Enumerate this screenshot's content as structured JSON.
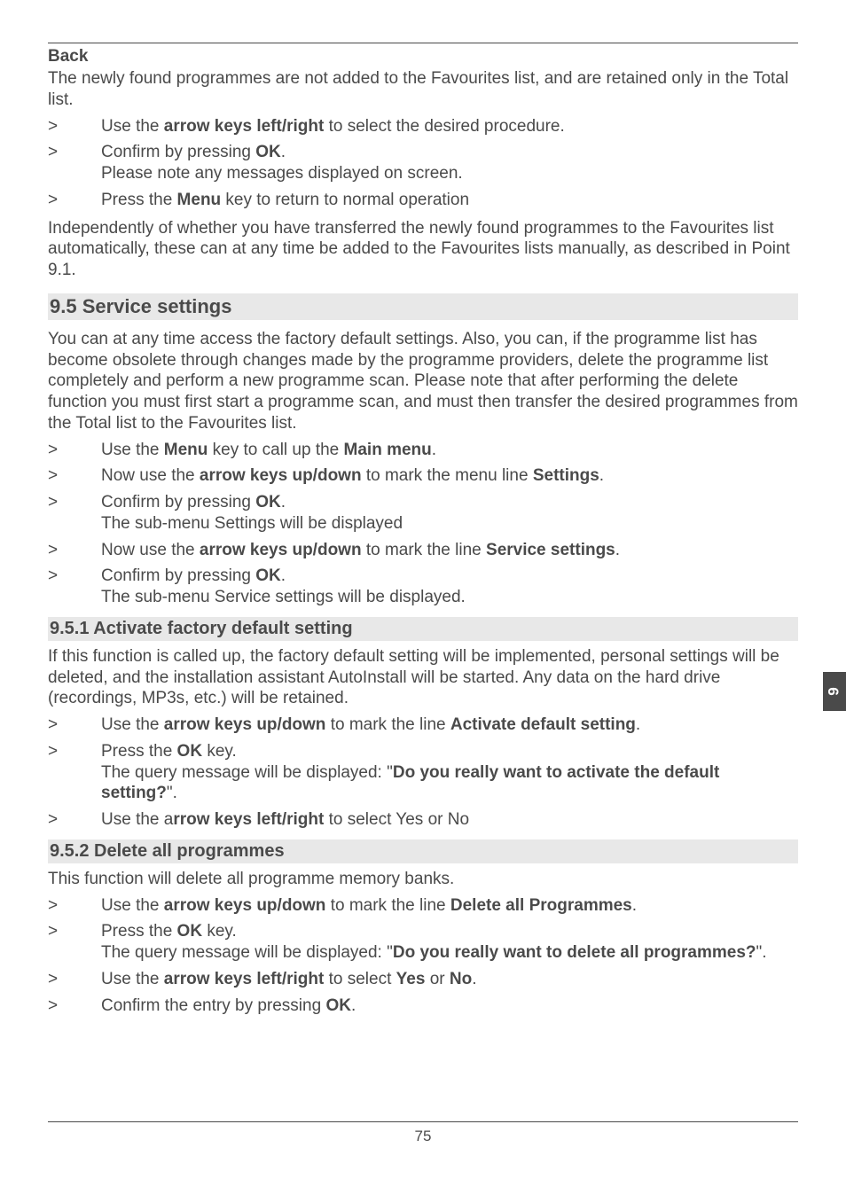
{
  "back": {
    "heading": "Back",
    "intro": "The newly found programmes are not added to the Favourites list, and are retained only in the Total list.",
    "items": [
      {
        "pre": "Use the ",
        "b1": "arrow keys left/right",
        "post": " to select the desired procedure."
      },
      {
        "pre": "Confirm by pressing ",
        "b1": "OK",
        "post": ".",
        "line2": "Please note any messages displayed on screen."
      },
      {
        "pre": "Press the ",
        "b1": "Menu",
        "post": " key to return to normal operation"
      }
    ],
    "outro": "Independently of whether you have transferred the newly found programmes to the Favourites list automatically, these can at any time be added to the Favourites lists manually, as described in Point 9.1."
  },
  "s95": {
    "heading": "9.5 Service settings",
    "intro": "You can at any time access the factory default settings. Also, you can, if the programme list has become obsolete through changes made by the programme providers, delete the programme list completely and perform a new programme scan. Please note that after performing the delete function you must first start a programme scan, and must then transfer the desired programmes from the Total list to the Favourites list.",
    "items": [
      {
        "pre": "Use the ",
        "b1": "Menu",
        "mid": " key to call up the ",
        "b2": "Main menu",
        "post": "."
      },
      {
        "pre": "Now use the ",
        "b1": "arrow keys up/down",
        "mid": " to mark the menu line ",
        "b2": "Settings",
        "post": "."
      },
      {
        "pre": "Confirm by pressing ",
        "b1": "OK",
        "post": ".",
        "line2": "The sub-menu Settings will be displayed"
      },
      {
        "pre": "Now use the ",
        "b1": "arrow keys up/down",
        "mid": " to mark the line ",
        "b2": "Service settings",
        "post": "."
      },
      {
        "pre": "Confirm by pressing ",
        "b1": "OK",
        "post": ".",
        "line2": "The sub-menu Service settings will be displayed."
      }
    ]
  },
  "s951": {
    "heading": "9.5.1 Activate factory default setting",
    "intro": "If this function is called up, the factory default setting will be implemented, personal settings will be deleted, and the installation assistant AutoInstall will be started. Any data on the hard drive (recordings, MP3s, etc.) will be retained.",
    "items": [
      {
        "pre": "Use the ",
        "b1": "arrow keys up/down",
        "mid": " to mark the line ",
        "b2": "Activate default setting",
        "post": "."
      },
      {
        "pre": "Press the ",
        "b1": "OK",
        "post": " key.",
        "line2pre": "The query message will be displayed: \"",
        "line2b": "Do you really want to activate the default setting?",
        "line2post": "\"."
      },
      {
        "pre": "Use the a",
        "b1": "rrow keys left/right",
        "post": " to select Yes or No"
      }
    ]
  },
  "s952": {
    "heading": "9.5.2 Delete all programmes",
    "intro": "This function will delete all programme memory banks.",
    "items": [
      {
        "pre": "Use the ",
        "b1": "arrow keys up/down",
        "mid": " to mark the line ",
        "b2": "Delete all Programmes",
        "post": "."
      },
      {
        "pre": "Press the ",
        "b1": "OK",
        "post": " key.",
        "line2pre": "The query message will be displayed: \"",
        "line2b": "Do you really want to delete all programmes?",
        "line2post": "\"."
      },
      {
        "pre": "Use the ",
        "b1": "arrow keys left/right",
        "mid": " to select ",
        "b2": "Yes",
        "mid2": " or ",
        "b3": "No",
        "post": "."
      },
      {
        "pre": "Confirm the entry by pressing ",
        "b1": "OK",
        "post": "."
      }
    ]
  },
  "footer": {
    "page": "75"
  },
  "sidetab": "9"
}
